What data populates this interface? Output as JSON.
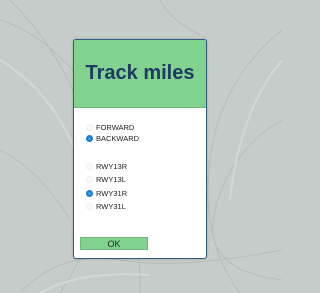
{
  "dialog": {
    "title": "Track miles",
    "direction_options": [
      {
        "label": "FORWARD",
        "selected": false
      },
      {
        "label": "BACKWARD",
        "selected": true
      }
    ],
    "runway_options": [
      {
        "label": "RWY13R",
        "selected": false
      },
      {
        "label": "RWY13L",
        "selected": false
      },
      {
        "label": "RWY31R",
        "selected": true
      },
      {
        "label": "RWY31L",
        "selected": false
      }
    ],
    "ok_label": "OK"
  },
  "colors": {
    "header": "#82d290",
    "title": "#1c3a63",
    "border": "#2f5f86",
    "radio_selected": "#1c7dcf",
    "background": "#c6ccca"
  }
}
